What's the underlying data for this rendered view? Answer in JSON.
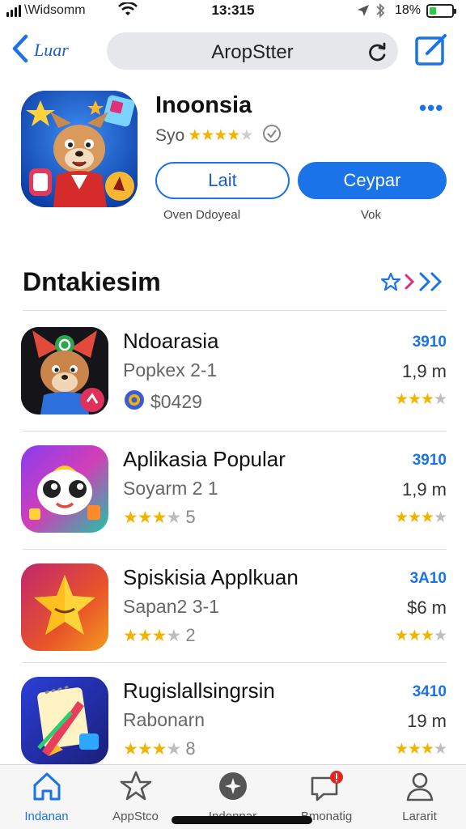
{
  "status": {
    "carrier": "\\Widsomm",
    "time": "13:315",
    "battery": "18%",
    "colors": {
      "battery_fill": "#2ecc40"
    }
  },
  "nav": {
    "back_label": "Luar",
    "title": "AropStter",
    "icons": {
      "back": "chevron-left-icon",
      "reload": "refresh-icon",
      "compose": "compose-icon"
    }
  },
  "hero": {
    "title": "Inoonsia",
    "subtitle": "Syo",
    "rating": 3.5,
    "more": "•••",
    "button_secondary": "Lait",
    "button_primary": "Ceypar",
    "caption_secondary": "Oven Ddoyeal",
    "caption_primary": "Vok"
  },
  "section": {
    "title": "Dntakiesim"
  },
  "apps": [
    {
      "name": "Ndoarasia",
      "subtitle": "Popkex 2-1",
      "price": "$0429",
      "right_top": "3910",
      "right_mid": "1,9 m",
      "rating_right": 3
    },
    {
      "name": "Aplikasia Popular",
      "subtitle": "Soyarm 2 1",
      "rating": 3,
      "count": "5",
      "right_top": "3910",
      "right_mid": "1,9 m",
      "rating_right": 3
    },
    {
      "name": "Spiskisia Applkuan",
      "subtitle": "Sapan2 3-1",
      "rating": 3,
      "count": "2",
      "right_top": "3A10",
      "right_mid": "$6 m",
      "rating_right": 3
    },
    {
      "name": "Rugislallsingrsin",
      "subtitle": "Rabonarn",
      "rating": 3,
      "count": "8",
      "right_top": "3410",
      "right_mid": "19 m",
      "rating_right": 3
    }
  ],
  "tabs": [
    {
      "label": "Indanan",
      "icon": "home-icon",
      "active": true
    },
    {
      "label": "AppStco",
      "icon": "star-icon",
      "active": false
    },
    {
      "label": "Indonpar",
      "icon": "compass-icon",
      "active": false
    },
    {
      "label": "Bmonatig",
      "icon": "chat-icon",
      "active": false
    },
    {
      "label": "Lararit",
      "icon": "person-icon",
      "active": false
    }
  ],
  "colors": {
    "accent": "#1a73e8",
    "star": "#f0b400",
    "badge": "#e0261d"
  }
}
